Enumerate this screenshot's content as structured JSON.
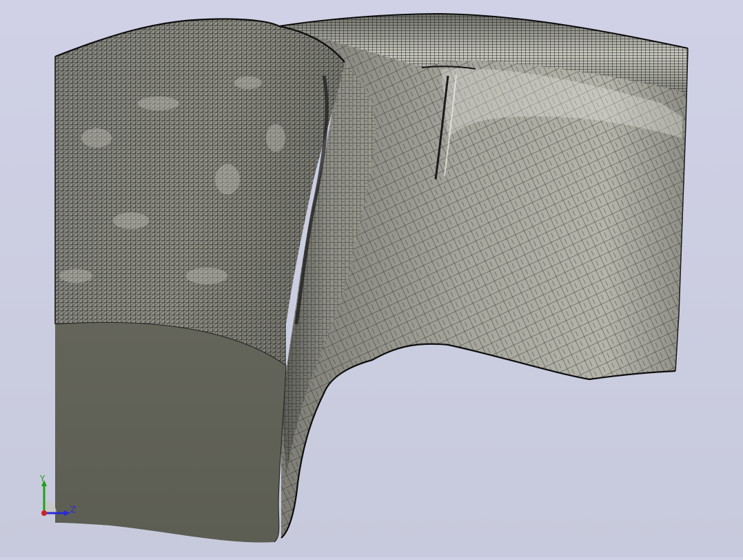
{
  "viewport": {
    "background_top": "#d0d1e6",
    "background_bottom": "#c7c9dc",
    "mesh_surface_color": "#8f8f86",
    "mesh_line_color": "#141414",
    "section_face_color": "#5f6055"
  },
  "triad": {
    "y_label": "Y",
    "z_label": "Z",
    "y_color": "#1ea01e",
    "z_color": "#2a2ad8",
    "x_color": "#d02020"
  }
}
